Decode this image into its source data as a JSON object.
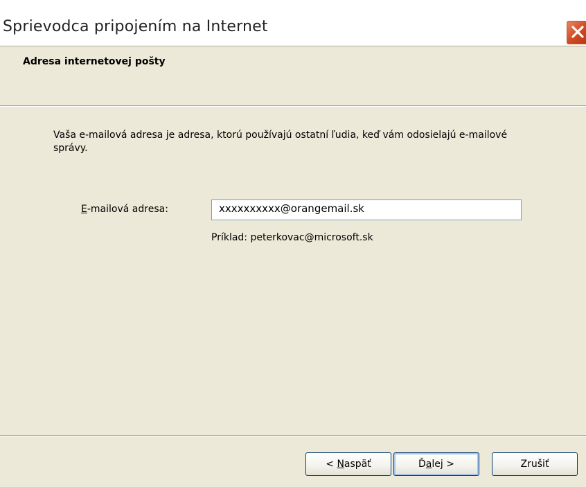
{
  "window": {
    "title": "Sprievodca pripojením na Internet"
  },
  "header": {
    "title": "Adresa internetovej pošty"
  },
  "body": {
    "description": "Vaša e-mailová adresa je adresa, ktorú používajú ostatní ľudia, keď vám odosielajú e-mailové správy.",
    "email_label_accel": "E",
    "email_label_rest": "-mailová adresa:",
    "email_value": "xxxxxxxxxx@orangemail.sk",
    "example": "Príklad: peterkovac@microsoft.sk"
  },
  "buttons": {
    "back_prefix": "< ",
    "back_accel": "N",
    "back_rest": "aspäť",
    "next_prefix": "Ď",
    "next_accel": "a",
    "next_rest": "lej >",
    "cancel": "Zrušiť"
  },
  "colors": {
    "close_button": "#d04a22",
    "dialog_background": "#ece9d8",
    "input_border": "#7f9db9",
    "default_button_border": "#003c74"
  },
  "icons": {
    "close": "close-icon"
  }
}
